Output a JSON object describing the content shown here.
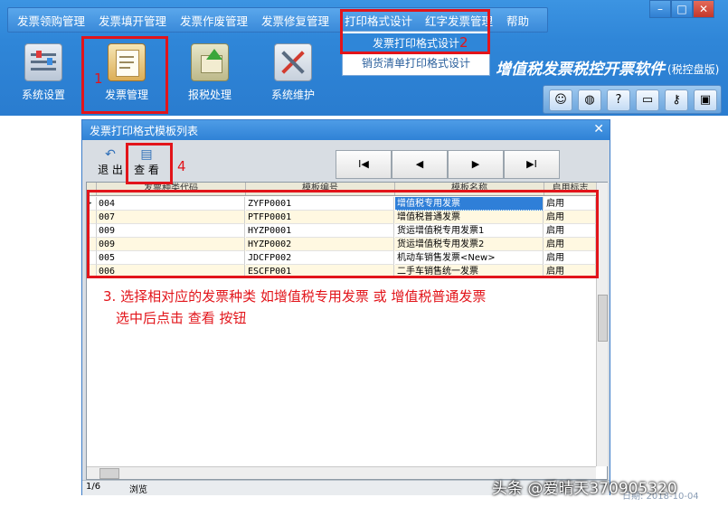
{
  "menu": {
    "items": [
      "发票领购管理",
      "发票填开管理",
      "发票作废管理",
      "发票修复管理",
      "打印格式设计",
      "红字发票管理",
      "帮助"
    ]
  },
  "window_controls": {
    "minimize": "–",
    "maximize": "□",
    "close": "✕"
  },
  "dropdown": {
    "items": [
      "发票打印格式设计",
      "销货清单打印格式设计"
    ]
  },
  "toolbar": {
    "items": [
      {
        "label": "系统设置",
        "icon": "settings-icon"
      },
      {
        "label": "发票管理",
        "icon": "invoice-management-icon"
      },
      {
        "label": "报税处理",
        "icon": "tax-report-icon"
      },
      {
        "label": "系统维护",
        "icon": "maintenance-tools-icon"
      }
    ]
  },
  "app": {
    "title": "增值税发票税控开票软件",
    "subtitle": "(税控盘版)"
  },
  "right_toolbar": {
    "icons": [
      "user-icon",
      "globe-icon",
      "help-icon",
      "window-icon",
      "key-icon",
      "lock-icon"
    ]
  },
  "dialog": {
    "title": "发票打印格式模板列表",
    "close": "✕",
    "buttons": {
      "exit": "退 出",
      "view": "查 看"
    },
    "nav": {
      "first": "I◀",
      "prev": "◀",
      "next": "▶",
      "last": "▶I"
    },
    "columns": [
      "发票种类代码",
      "模板编号",
      "模板名称",
      "启用标志"
    ],
    "rows": [
      {
        "code": "004",
        "template_no": "ZYFP0001",
        "name": "增值税专用发票",
        "status": "启用"
      },
      {
        "code": "007",
        "template_no": "PTFP0001",
        "name": "增值税普通发票",
        "status": "启用"
      },
      {
        "code": "009",
        "template_no": "HYZP0001",
        "name": "货运增值税专用发票1",
        "status": "启用"
      },
      {
        "code": "009",
        "template_no": "HYZP0002",
        "name": "货运增值税专用发票2",
        "status": "启用"
      },
      {
        "code": "005",
        "template_no": "JDCFP002",
        "name": "机动车销售发票<New>",
        "status": "启用"
      },
      {
        "code": "006",
        "template_no": "ESCFP001",
        "name": "二手车销售统一发票",
        "status": "启用"
      }
    ],
    "status_page": "1/6",
    "status_mode": "浏览"
  },
  "annotations": {
    "num1": "1",
    "num2": "2",
    "num4": "4",
    "instruction_line1": "3. 选择相对应的发票种类  如增值税专用发票  或  增值税普通发票",
    "instruction_line2": "选中后点击  查看  按钮"
  },
  "watermark": "头条 @爱晴天370905320",
  "date_footer": "日期: 2018-10-04",
  "colors": {
    "annotation_red": "#e2141a",
    "topbar_blue": "#2f86d8",
    "selection_blue": "#2f7fd8",
    "row_alt": "#fff8e1"
  }
}
